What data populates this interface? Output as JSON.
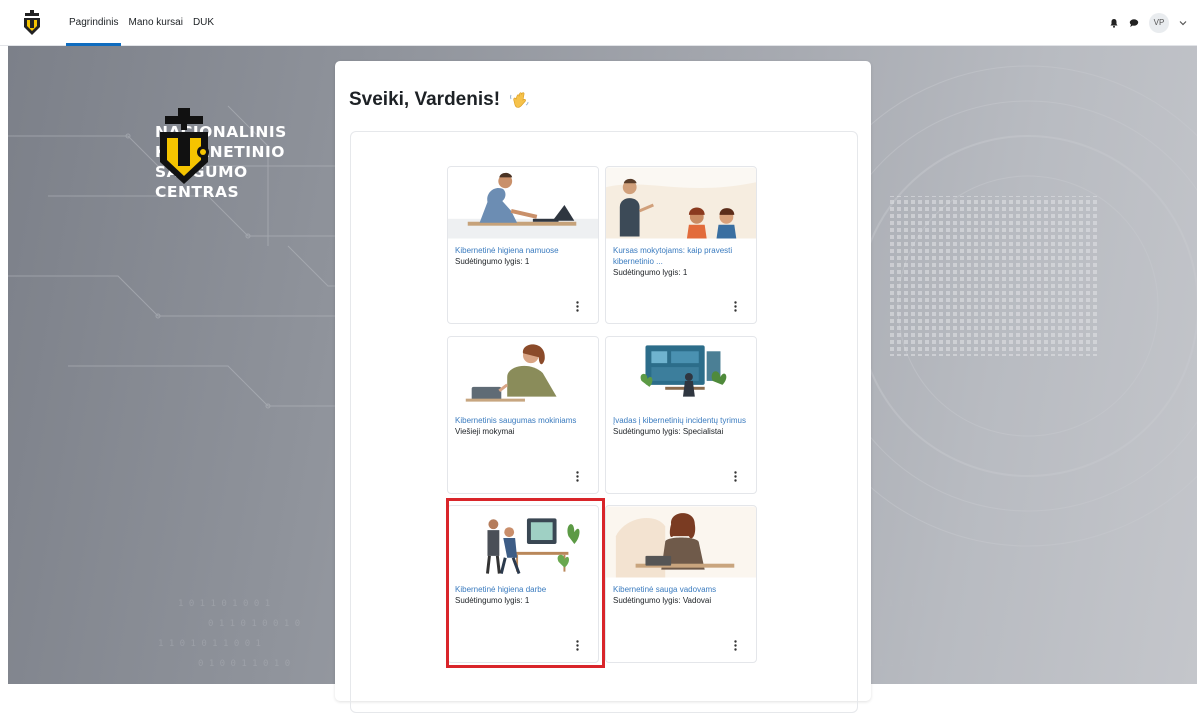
{
  "nav": {
    "links": [
      "Pagrindinis",
      "Mano kursai",
      "DUK"
    ],
    "active_index": 0,
    "user_initials": "VP",
    "icons": [
      "shield-logo-icon",
      "bell-icon",
      "chat-icon",
      "chevron-down-icon"
    ]
  },
  "brand": {
    "line1": "NACIONALINIS",
    "line2": "KIBERNETINIO",
    "line3": "SAUGUMO",
    "line4": "CENTRAS"
  },
  "greeting": "Sveiki, Vardenis!",
  "courses": [
    {
      "title": "Kibernetinė higiena namuose",
      "subtitle": "Sudėtingumo lygis: 1"
    },
    {
      "title": "Kursas mokytojams: kaip pravesti kibernetinio ...",
      "subtitle": "Sudėtingumo lygis: 1"
    },
    {
      "title": "Kibernetinis saugumas mokiniams",
      "subtitle": "Viešieji mokymai"
    },
    {
      "title": "Įvadas į kibernetinių incidentų tyrimus",
      "subtitle": "Sudėtingumo lygis: Specialistai"
    },
    {
      "title": "Kibernetinė higiena darbe",
      "subtitle": "Sudėtingumo lygis: 1",
      "highlighted": true
    },
    {
      "title": "Kibernetinė sauga vadovams",
      "subtitle": "Sudėtingumo lygis: Vadovai"
    }
  ],
  "colors": {
    "accent": "#0f6cbf",
    "link": "#3a7bbf",
    "highlight": "#d9252a",
    "brand_yellow": "#f5c400"
  }
}
